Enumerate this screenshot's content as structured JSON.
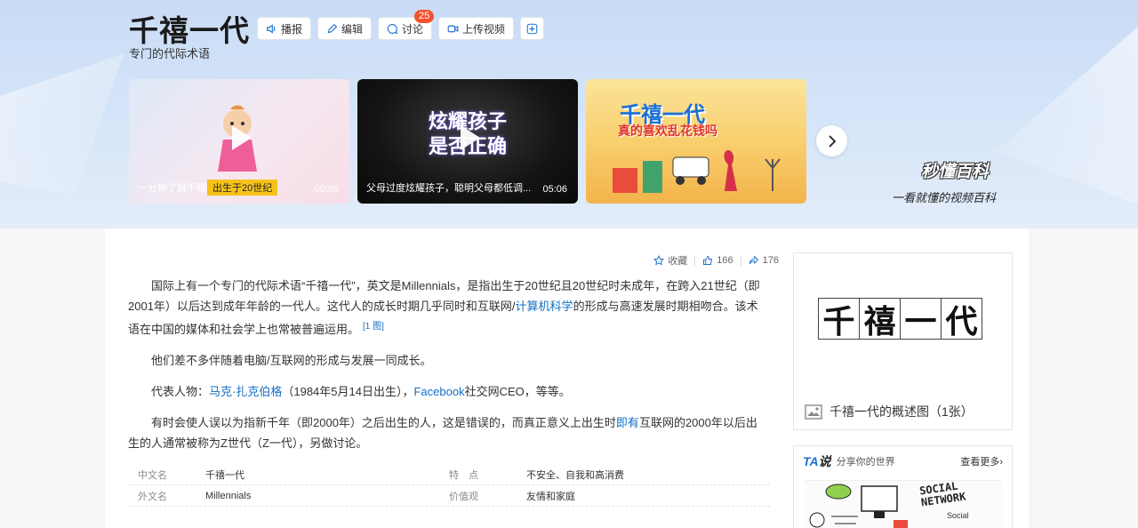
{
  "header": {
    "title": "千禧一代",
    "subtitle": "专门的代际术语",
    "toolbar": {
      "broadcast": "播报",
      "edit": "编辑",
      "discuss": "讨论",
      "discuss_badge": "25",
      "upload": "上传视频"
    }
  },
  "videos": [
    {
      "caption": "一分钟了解千禧一代",
      "tag": "出生于20世纪",
      "duration": "00:58"
    },
    {
      "caption": "父母过度炫耀孩子，聪明父母都低调...",
      "overlay_line1": "炫耀孩子",
      "overlay_line2": "是否正确",
      "duration": "05:06"
    },
    {
      "title": "千禧一代",
      "subtitle": "真的喜欢乱花钱吗"
    }
  ],
  "brand": {
    "name": "秒懂百科",
    "slogan": "一看就懂的视频百科"
  },
  "actions": {
    "collect": "收藏",
    "likes": "166",
    "shares": "176"
  },
  "article": {
    "p1_a": "国际上有一个专门的代际术语“千禧一代”，英文是Millennials，是指出生于20世纪且20世纪时未成年，在跨入21世纪（即2001年）以后达到成年年龄的一代人。这代人的成长时期几乎同时和互联网/",
    "p1_link": "计算机科学",
    "p1_b": "的形成与高速发展时期相吻合。该术语在中国的媒体和社会学上也常被普遍运用。",
    "p1_cite": "[1 图]",
    "p2": "他们差不多伴随着电脑/互联网的形成与发展一同成长。",
    "p3_a": "代表人物：",
    "p3_link1": "马克·扎克伯格",
    "p3_b": "（1984年5月14日出生），",
    "p3_link2": "Facebook",
    "p3_c": "社交网CEO，等等。",
    "p4_a": "有时会使人误以为指新千年（即2000年）之后出生的人，这是错误的，而真正意义上出生时",
    "p4_link": "即有",
    "p4_b": "互联网的2000年以后出生的人通常被称为Z世代（Z一代），另做讨论。"
  },
  "infobox": [
    {
      "label": "中文名",
      "value": "千禧一代",
      "label2": "特　点",
      "value2": "不安全、自我和高消费"
    },
    {
      "label": "外文名",
      "value": "Millennials",
      "label2": "价值观",
      "value2": "友情和家庭"
    }
  ],
  "side_card": {
    "chars": [
      "千",
      "禧",
      "一",
      "代"
    ],
    "caption": "千禧一代的概述图（1张）"
  },
  "ta_card": {
    "logo_a": "TA",
    "logo_b": "说",
    "slogan": "分享你的世界",
    "more": "查看更多",
    "img_text1": "SOCIAL",
    "img_text2": "NETWORK",
    "img_text3": "Social"
  },
  "colors": {
    "link": "#136ec2",
    "badge": "#f3522d",
    "banner": "#d6e5f8"
  }
}
